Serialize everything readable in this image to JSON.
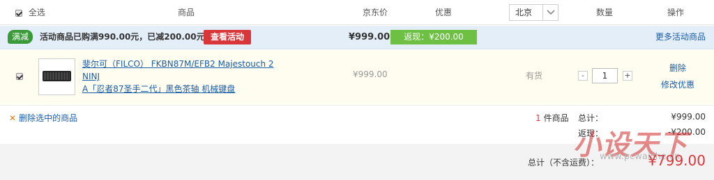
{
  "header": {
    "select_all": "全选",
    "col_product": "商品",
    "col_price": "京东价",
    "col_discount": "优惠",
    "region": "北京",
    "col_qty": "数量",
    "col_action": "操作"
  },
  "promo": {
    "badge": "满减",
    "text": "活动商品已购满990.00元，已减200.00元",
    "button": "查看活动",
    "total": "¥999.00",
    "rebate": "返现：¥200.00",
    "more": "更多活动商品"
  },
  "item": {
    "title_line1": "斐尔可（FILCO） FKBN87M/EFB2 Majestouch 2 NINJ",
    "title_line2": "A「忍者87圣手二代」黑色茶轴 机械键盘",
    "price": "¥999.00",
    "stock": "有货",
    "qty": "1",
    "minus": "-",
    "plus": "+",
    "action_delete": "删除",
    "action_edit": "修改优惠"
  },
  "summary": {
    "delete_selected": "删除选中的商品",
    "count_num": "1",
    "count_label": "件商品",
    "total_label": "总计：",
    "total_value": "¥999.00",
    "rebate_label": "返现：",
    "rebate_value": "-¥200.00",
    "grand_label": "总计（不含运费）：",
    "grand_value": "¥799.00"
  },
  "watermark": {
    "text": "小设天下",
    "url": "www.pcwaiche.cn"
  },
  "colors": {
    "accent_red": "#d9363a",
    "link_blue": "#1a5da8",
    "promo_bg": "#e4eef9",
    "rebate_green": "#6ec045"
  }
}
